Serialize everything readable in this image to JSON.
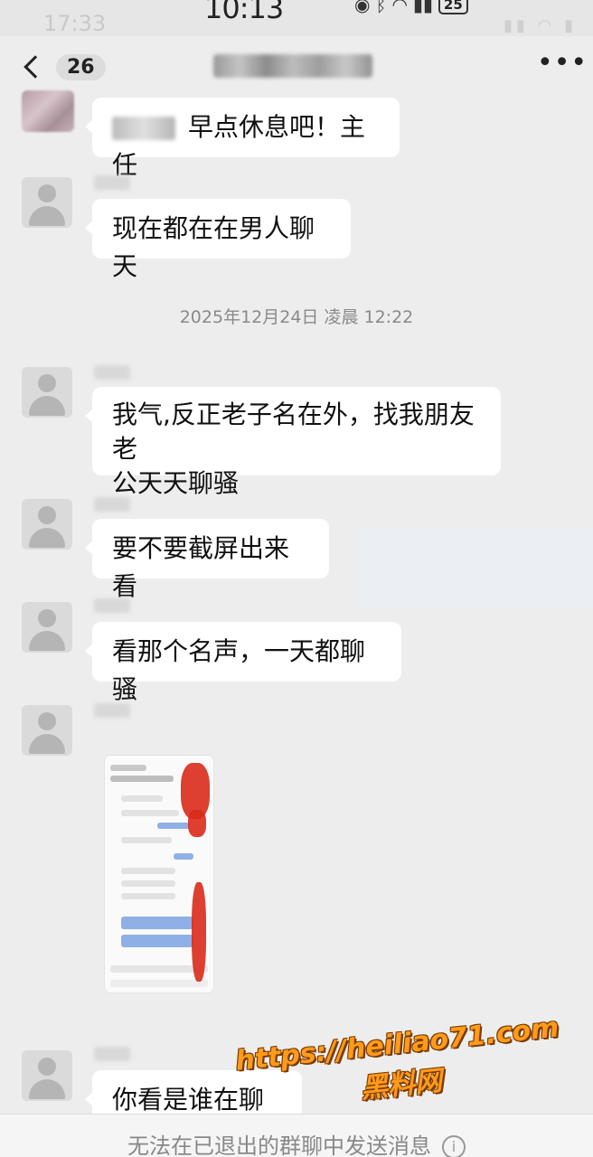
{
  "status": {
    "outer_time": "17:33",
    "inner_time": "10:13",
    "battery": "25"
  },
  "nav": {
    "back_count": "26",
    "more": "•••"
  },
  "messages": [
    {
      "text": "早点休息吧！主任"
    },
    {
      "text": "现在都在在男人聊天"
    },
    {
      "text": "我气,反正老子名在外，找我朋友老"
    },
    {
      "text": "公天天聊骚"
    },
    {
      "text": "要不要截屏出来看"
    },
    {
      "text": "看那个名声，一天都聊骚"
    },
    {
      "text": "你看是谁在聊骚"
    }
  ],
  "timestamp": "2025年12月24日 凌晨 12:22",
  "bottom": {
    "notice": "无法在已退出的群聊中发送消息",
    "info_icon": "info-icon"
  },
  "watermark": {
    "url": "https://heiliao71.com",
    "brand": "黑料网"
  }
}
